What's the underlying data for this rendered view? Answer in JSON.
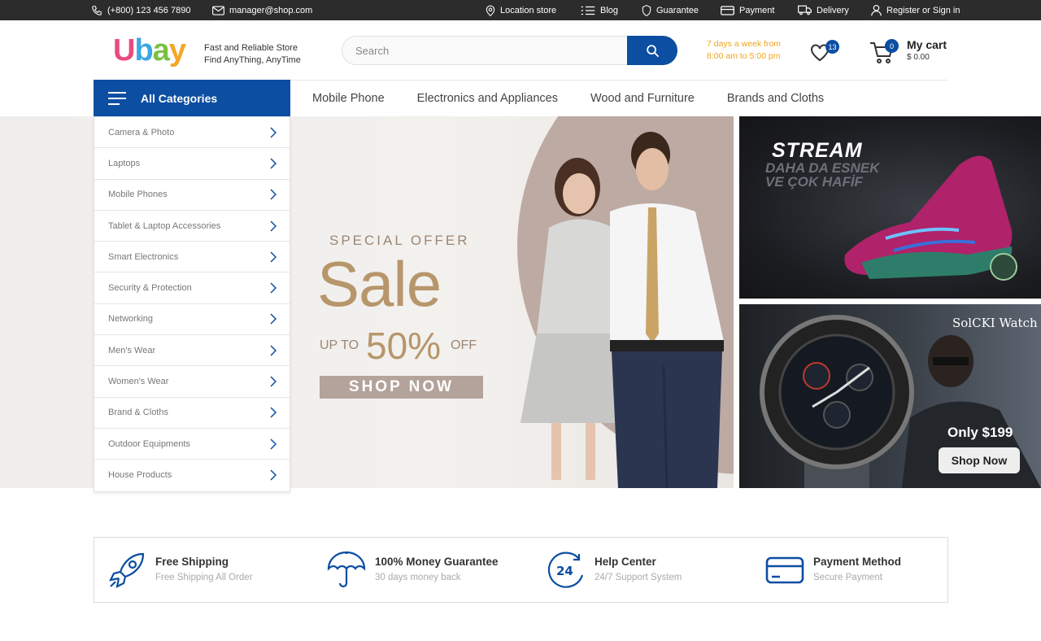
{
  "topbar": {
    "phone": "(+800) 123 456 7890",
    "email": "manager@shop.com",
    "links": [
      {
        "label": "Location store",
        "icon": "location-pin-icon"
      },
      {
        "label": "Blog",
        "icon": "list-icon"
      },
      {
        "label": "Guarantee",
        "icon": "shield-icon"
      },
      {
        "label": "Payment",
        "icon": "credit-card-icon"
      },
      {
        "label": "Delivery",
        "icon": "truck-icon"
      },
      {
        "label": "Register or Sign in",
        "icon": "user-icon"
      }
    ]
  },
  "header": {
    "logo": "Ubay",
    "tagline_1": "Fast and Reliable Store",
    "tagline_2": "Find AnyThing, AnyTime",
    "search_placeholder": "Search",
    "hours_1": "7 days a week from",
    "hours_2": "8:00 am to 5:00 pm",
    "wishlist_count": "13",
    "cart_count": "0",
    "cart_title": "My cart",
    "cart_total": "$ 0.00"
  },
  "nav": {
    "all_categories": "All Categories",
    "items": [
      "Mobile Phone",
      "Electronics and Appliances",
      "Wood and Furniture",
      "Brands and Cloths"
    ]
  },
  "categories": [
    "Camera & Photo",
    "Laptops",
    "Mobile Phones",
    "Tablet & Laptop Accessories",
    "Smart Electronics",
    "Security & Protection",
    "Networking",
    "Men's Wear",
    "Women's Wear",
    "Brand & Cloths",
    "Outdoor Equipments",
    "House Products"
  ],
  "hero": {
    "special": "SPECIAL OFFER",
    "sale": "Sale",
    "upto": "UP TO",
    "percent": "50%",
    "off": "OFF",
    "button": "SHOP NOW"
  },
  "banner_shoe": {
    "title": "STREAM",
    "sub_1": "DAHA DA ESNEK",
    "sub_2": "VE ÇOK HAFİF"
  },
  "banner_watch": {
    "title": "SolCKI Watch",
    "price": "Only $199",
    "button": "Shop Now"
  },
  "features": [
    {
      "title": "Free Shipping",
      "sub": "Free Shipping All Order",
      "icon": "rocket-icon"
    },
    {
      "title": "100% Money Guarantee",
      "sub": "30 days money back",
      "icon": "umbrella-icon"
    },
    {
      "title": "Help Center",
      "sub": "24/7 Support System",
      "icon": "support-24-icon"
    },
    {
      "title": "Payment Method",
      "sub": "Secure Payment",
      "icon": "card-icon"
    }
  ],
  "colors": {
    "primary": "#0b4ea2",
    "accent": "#f2a51a",
    "sale_gold": "#b7966b"
  }
}
